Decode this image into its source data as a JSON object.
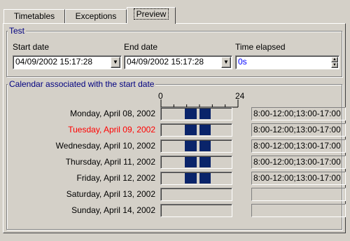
{
  "tabs": [
    {
      "label": "Timetables",
      "active": false
    },
    {
      "label": "Exceptions",
      "active": false
    },
    {
      "label": "Preview",
      "active": true
    }
  ],
  "test_group": {
    "title": "Test",
    "start_date_label": "Start date",
    "start_date_value": "04/09/2002 15:17:28",
    "end_date_label": "End date",
    "end_date_value": "04/09/2002 15:17:28",
    "time_elapsed_label": "Time elapsed",
    "time_elapsed_value": "0s"
  },
  "calendar_group": {
    "title": "Calendar associated with the start date",
    "scale_start": "0",
    "scale_end": "24",
    "days": [
      {
        "label": "Monday, April 08, 2002",
        "highlight": false,
        "hours": "8:00-12:00;13:00-17:00",
        "segments": [
          [
            8,
            12
          ],
          [
            13,
            17
          ]
        ]
      },
      {
        "label": "Tuesday, April 09, 2002",
        "highlight": true,
        "hours": "8:00-12:00;13:00-17:00",
        "segments": [
          [
            8,
            12
          ],
          [
            13,
            17
          ]
        ]
      },
      {
        "label": "Wednesday, April 10, 2002",
        "highlight": false,
        "hours": "8:00-12:00;13:00-17:00",
        "segments": [
          [
            8,
            12
          ],
          [
            13,
            17
          ]
        ]
      },
      {
        "label": "Thursday, April 11, 2002",
        "highlight": false,
        "hours": "8:00-12:00;13:00-17:00",
        "segments": [
          [
            8,
            12
          ],
          [
            13,
            17
          ]
        ]
      },
      {
        "label": "Friday, April 12, 2002",
        "highlight": false,
        "hours": "8:00-12:00;13:00-17:00",
        "segments": [
          [
            8,
            12
          ],
          [
            13,
            17
          ]
        ]
      },
      {
        "label": "Saturday, April 13, 2002",
        "highlight": false,
        "hours": "",
        "segments": []
      },
      {
        "label": "Sunday, April 14, 2002",
        "highlight": false,
        "hours": "",
        "segments": []
      }
    ]
  },
  "colors": {
    "highlight_text": "#ff0000",
    "group_title": "#000080",
    "bar_fill": "#0a246a",
    "elapsed_text": "#0000ff"
  }
}
